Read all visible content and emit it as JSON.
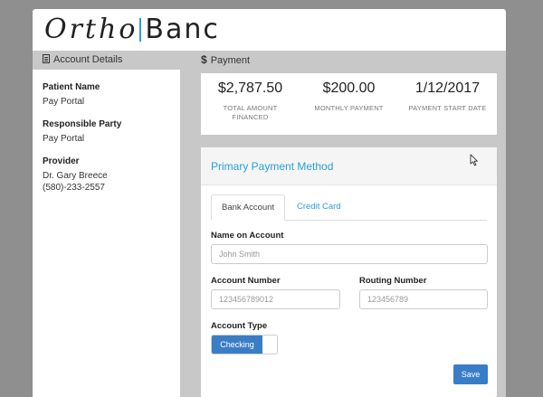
{
  "brand": {
    "part1": "Ortho",
    "part2": "Banc"
  },
  "account_details": {
    "header": "Account Details",
    "patient_name_label": "Patient Name",
    "patient_name": "Pay Portal",
    "responsible_party_label": "Responsible Party",
    "responsible_party": "Pay Portal",
    "provider_label": "Provider",
    "provider_name": "Dr. Gary Breece",
    "provider_phone": "(580)-233-2557"
  },
  "payment": {
    "header": "Payment",
    "summary": [
      {
        "value": "$2,787.50",
        "label_line1": "TOTAL AMOUNT",
        "label_line2": "FINANCED"
      },
      {
        "value": "$200.00",
        "label_line1": "MONTHLY PAYMENT",
        "label_line2": ""
      },
      {
        "value": "1/12/2017",
        "label_line1": "PAYMENT START DATE",
        "label_line2": ""
      }
    ],
    "method_title": "Primary Payment Method",
    "tabs": {
      "active": "Bank Account",
      "inactive": "Credit Card"
    },
    "name_on_account": {
      "label": "Name on Account",
      "placeholder": "John Smith"
    },
    "account_number": {
      "label": "Account Number",
      "placeholder": "123456789012"
    },
    "routing_number": {
      "label": "Routing Number",
      "placeholder": "123456789"
    },
    "account_type": {
      "label": "Account Type",
      "selected": "Checking"
    },
    "save_label": "Save"
  },
  "colors": {
    "accent": "#2a9fd6",
    "primary_button": "#3a7dc7"
  },
  "icons": {
    "account_details": "document-icon",
    "payment": "dollar-icon",
    "cursor": "mouse-pointer-icon"
  }
}
